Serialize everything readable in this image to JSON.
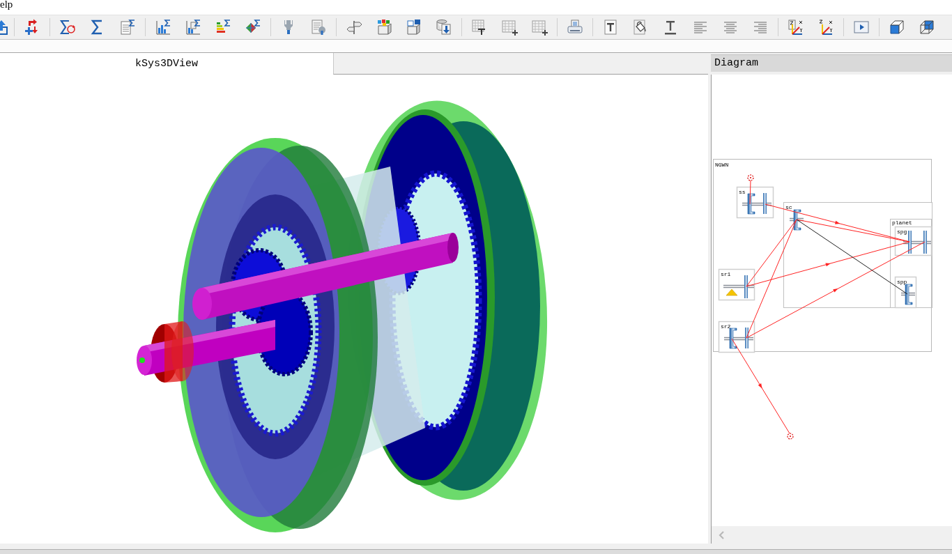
{
  "menu_bar": {
    "items": [
      {
        "label": "elp"
      }
    ]
  },
  "view_panel": {
    "tabs": [
      {
        "label": "kSys3DView",
        "selected": true
      }
    ]
  },
  "diagram_panel": {
    "title": "Diagram",
    "diagram": {
      "title": "NGWN",
      "nodes": [
        {
          "label": "ss",
          "kind": "coupled"
        },
        {
          "label": "sc",
          "kind": "carrier",
          "children": [
            {
              "label": "planet",
              "kind": "group",
              "children": [
                {
                  "label": "spg",
                  "kind": "twin"
                },
                {
                  "label": "spp",
                  "kind": "hub"
                }
              ]
            }
          ]
        },
        {
          "label": "sr1",
          "kind": "grounded"
        },
        {
          "label": "sr2",
          "kind": "coupled"
        }
      ]
    }
  }
}
